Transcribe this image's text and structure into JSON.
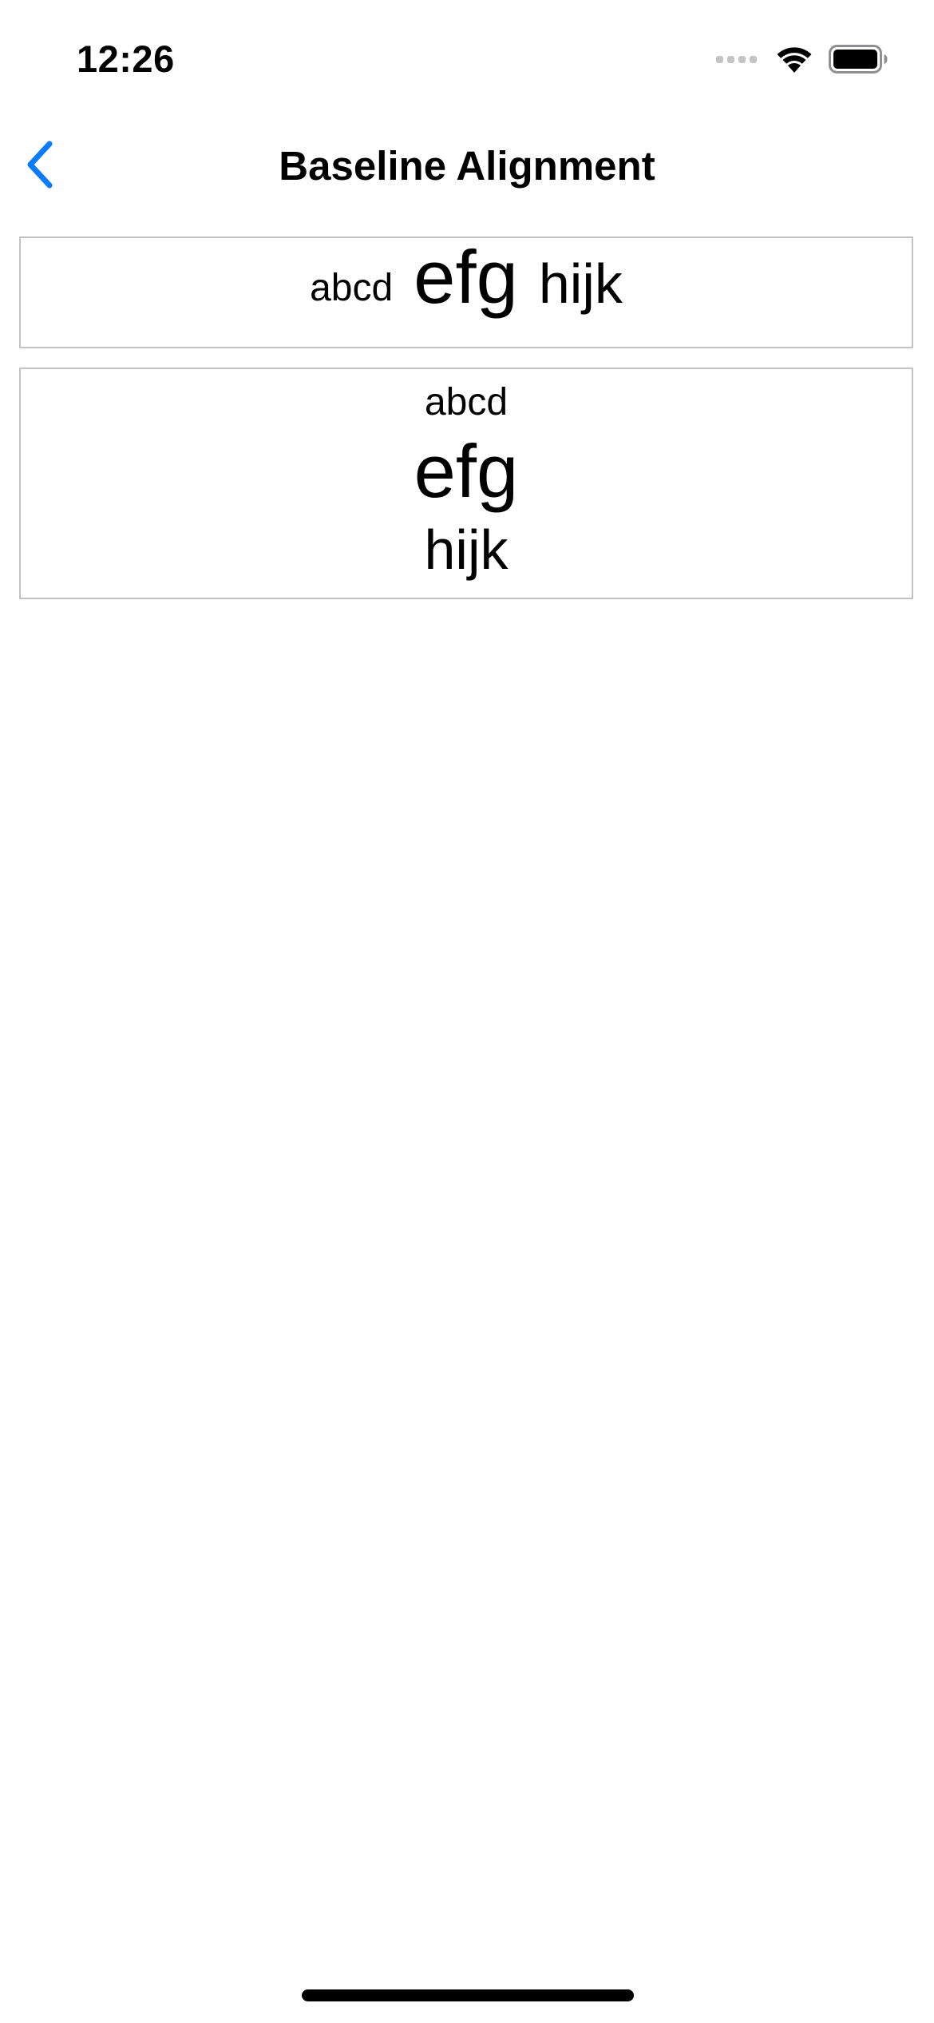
{
  "status_bar": {
    "time": "12:26",
    "icons": [
      "cellular-signal-icon",
      "wifi-icon",
      "battery-icon"
    ]
  },
  "nav": {
    "title": "Baseline Alignment",
    "back_icon": "chevron-left-icon"
  },
  "colors": {
    "accent": "#0a7aff",
    "border": "#c2c2c4",
    "text": "#000000",
    "background": "#ffffff"
  },
  "horizontal_demo": {
    "small": "abcd",
    "large": "efg",
    "medium": "hijk"
  },
  "vertical_demo": {
    "small": "abcd",
    "large": "efg",
    "medium": "hijk"
  }
}
